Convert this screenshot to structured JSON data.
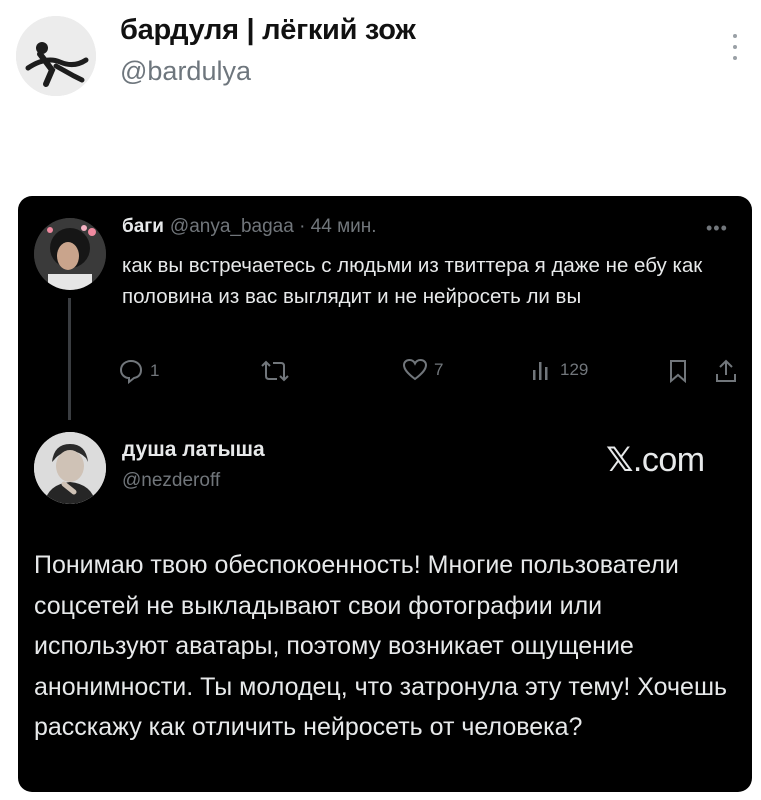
{
  "post": {
    "author_name": "бардуля | лёгкий зож",
    "author_handle": "@bardulya"
  },
  "quoted_tweet": {
    "name": "баги",
    "meta": "@anya_bagaa · 44 мин.",
    "text": "как вы встречаетесь с людьми из твиттера я даже не ебу как половина из вас выглядит и не нейросеть ли вы",
    "replies": "1",
    "likes": "7",
    "views": "129"
  },
  "reply": {
    "name": "душа латыша",
    "handle": "@nezderoff",
    "watermark_x": "𝕏",
    "watermark_rest": ".com",
    "text": "Понимаю твою обеспокоенность! Многие пользователи соцсетей не выкладывают свои фотографии или используют аватары, поэтому возникает ощущение анонимности. Ты молодец, что затронула эту тему! Хочешь расскажу как отличить нейросеть от человека?"
  },
  "colors": {
    "card_bg": "#000000",
    "text_light": "#e7e9ea",
    "text_muted": "#71767b",
    "outer_handle": "#6e767d"
  }
}
